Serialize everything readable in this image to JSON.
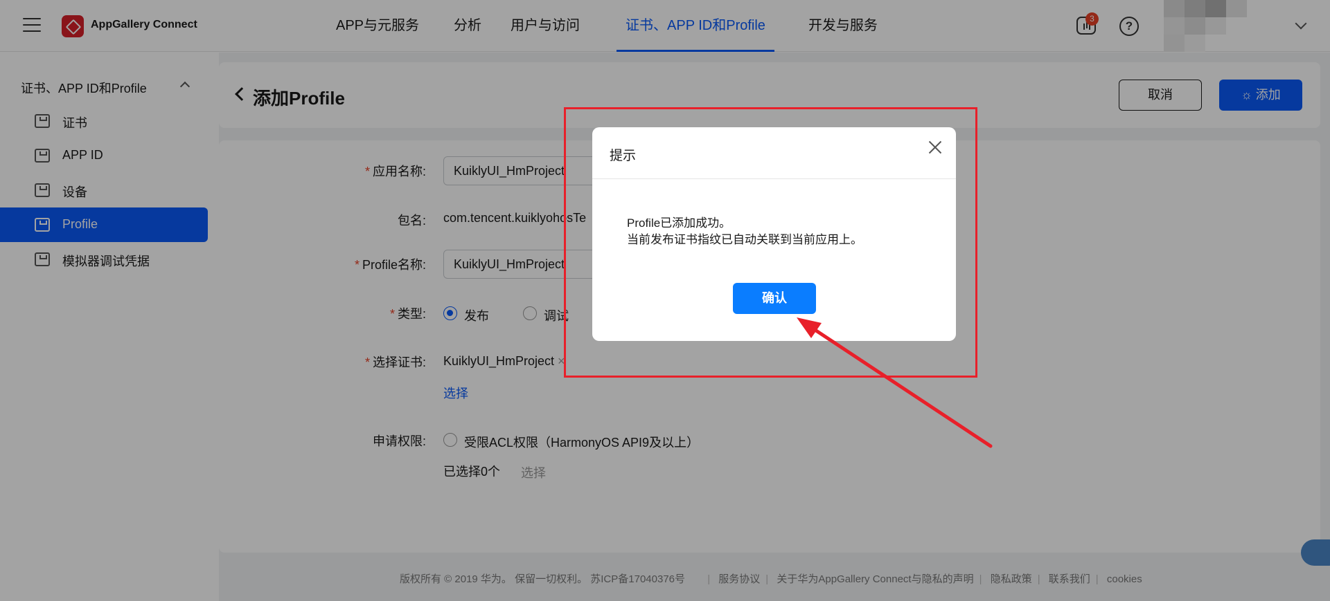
{
  "topbar": {
    "brand": "AppGallery Connect",
    "nav": [
      "APP与元服务",
      "分析",
      "用户与访问",
      "证书、APP ID和Profile",
      "开发与服务"
    ],
    "active_nav_index": 3,
    "badge_count": "3",
    "help_glyph": "?"
  },
  "sidebar": {
    "group_label": "证书、APP ID和Profile",
    "items": [
      "证书",
      "APP ID",
      "设备",
      "Profile",
      "模拟器调试凭据"
    ],
    "active_index": 3
  },
  "header": {
    "title": "添加Profile",
    "cancel_label": "取消",
    "add_label": "添加"
  },
  "form": {
    "app_name_label": "应用名称:",
    "app_name_value": "KuiklyUI_HmProject",
    "package_label": "包名:",
    "package_value": "com.tencent.kuiklyohosTe",
    "profile_name_label": "Profile名称:",
    "profile_name_value": "KuiklyUI_HmProject",
    "type_label": "类型:",
    "type_release": "发布",
    "type_debug": "调试",
    "type_selected": "发布",
    "cert_label": "选择证书:",
    "cert_value": "KuiklyUI_HmProject",
    "cert_remove": "×",
    "cert_select": "选择",
    "permission_label": "申请权限:",
    "permission_option": "受限ACL权限（HarmonyOS API9及以上）",
    "selected_count": "已选择0个",
    "permission_select": "选择"
  },
  "footer": {
    "copyright": "版权所有 © 2019 华为。 保留一切权利。 苏ICP备17040376号",
    "links": [
      "服务协议",
      "关于华为AppGallery Connect与隐私的声明",
      "隐私政策",
      "联系我们",
      "cookies"
    ]
  },
  "dialog": {
    "title": "提示",
    "message_line1": "Profile已添加成功。",
    "message_line2": "当前发布证书指纹已自动关联到当前应用上。",
    "confirm_label": "确认"
  },
  "colors": {
    "accent": "#0a59f7",
    "annotation_red": "#e8202a",
    "badge": "#e84026",
    "confirm_button": "#0a7dff"
  }
}
